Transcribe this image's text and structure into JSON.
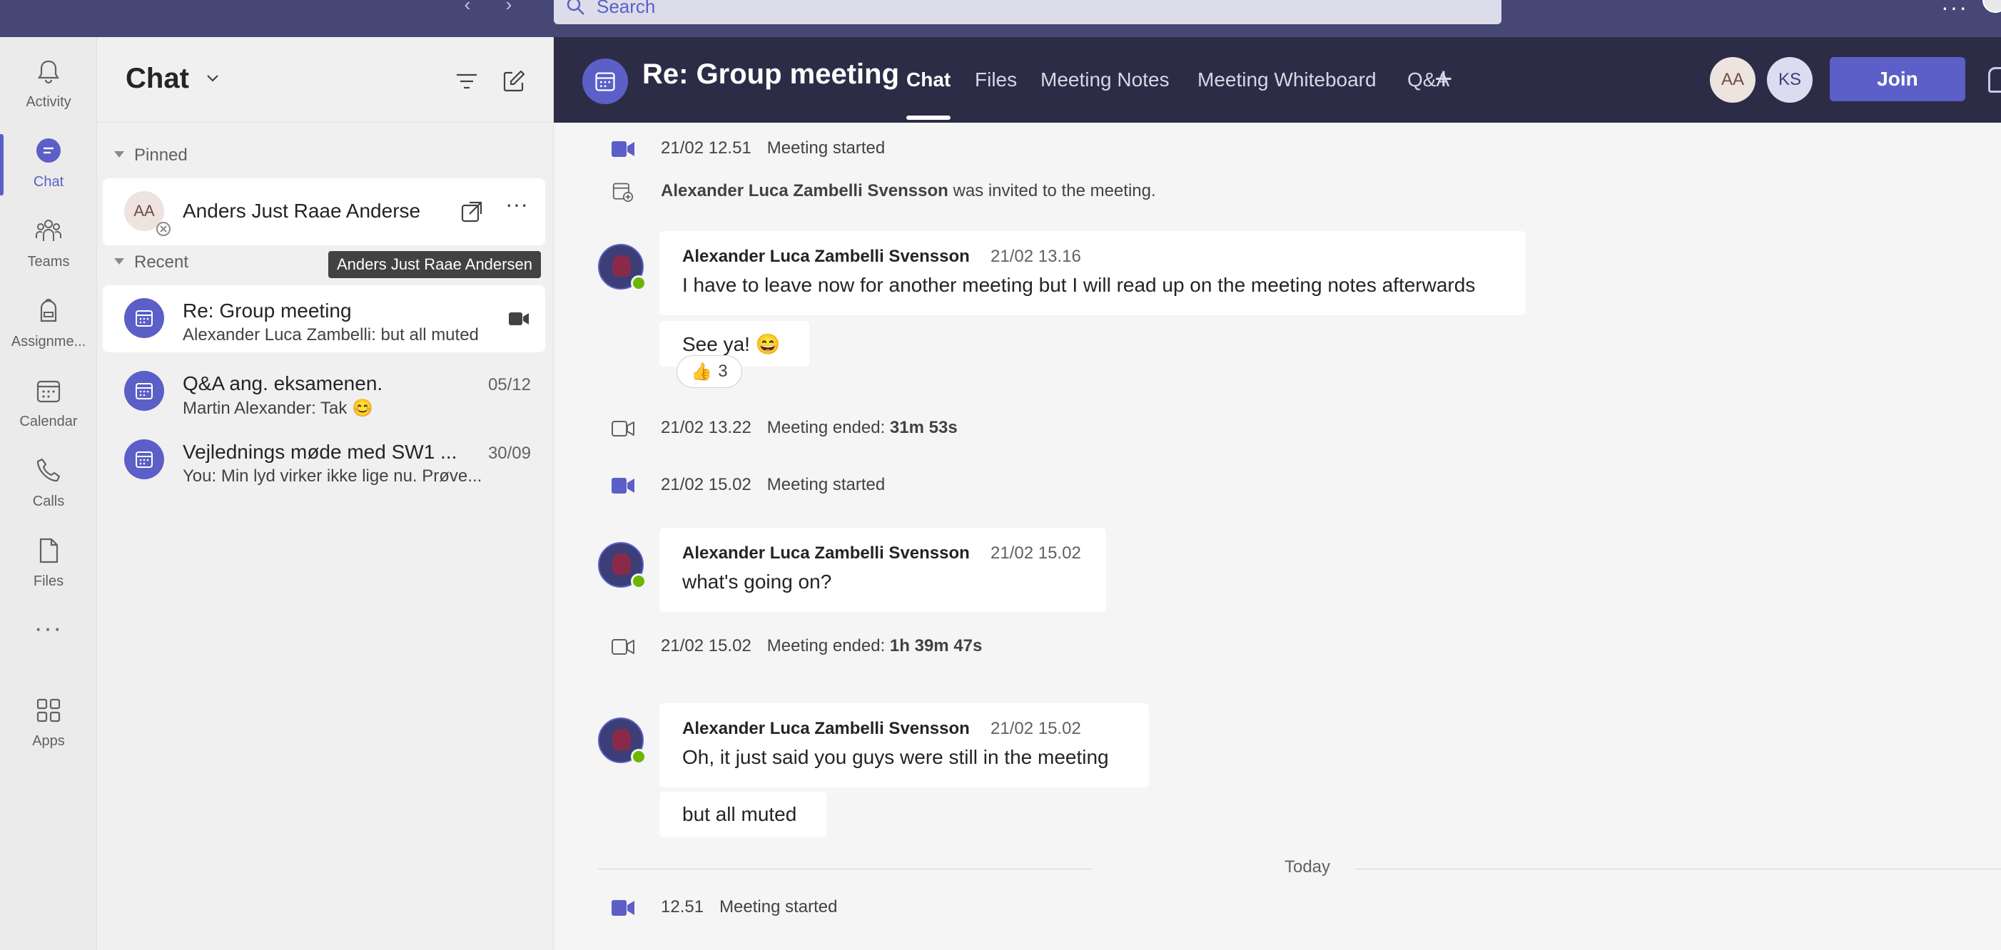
{
  "topbar": {
    "search_placeholder": "Search",
    "back_icon": "chevron-left-icon",
    "forward_icon": "chevron-right-icon"
  },
  "rail": {
    "items": [
      {
        "label": "Activity",
        "icon": "bell-icon"
      },
      {
        "label": "Chat",
        "icon": "chat-icon",
        "active": true
      },
      {
        "label": "Teams",
        "icon": "teams-icon"
      },
      {
        "label": "Assignme...",
        "icon": "backpack-icon"
      },
      {
        "label": "Calendar",
        "icon": "calendar-icon"
      },
      {
        "label": "Calls",
        "icon": "phone-icon"
      },
      {
        "label": "Files",
        "icon": "file-icon"
      },
      {
        "label": "Apps",
        "icon": "apps-icon"
      }
    ]
  },
  "list": {
    "title": "Chat",
    "pinned_label": "Pinned",
    "recent_label": "Recent",
    "pinned": [
      {
        "initials": "AA",
        "name": "Anders Just Raae Andersen",
        "display_name": "Anders Just Raae Anderse"
      }
    ],
    "tooltip": "Anders Just Raae Andersen",
    "recent": [
      {
        "name": "Re: Group meeting",
        "preview": "Alexander Luca Zambelli: but all muted",
        "date": ""
      },
      {
        "name": "Q&A ang. eksamenen.",
        "preview": "Martin Alexander: Tak 😊",
        "date": "05/12"
      },
      {
        "name": "Vejlednings møde med SW1 ...",
        "preview": "You: Min lyd virker ikke lige nu. Prøve...",
        "date": "30/09"
      }
    ]
  },
  "header": {
    "title": "Re: Group meeting",
    "tabs": [
      {
        "label": "Chat",
        "active": true
      },
      {
        "label": "Files"
      },
      {
        "label": "Meeting Notes"
      },
      {
        "label": "Meeting Whiteboard"
      },
      {
        "label": "Q&A"
      }
    ],
    "participants": [
      {
        "initials": "AA",
        "bg": "#ede3df",
        "fg": "#6b4e44"
      },
      {
        "initials": "KS",
        "bg": "#dcdcf0",
        "fg": "#3e3f7a"
      }
    ],
    "join_label": "Join"
  },
  "conversation": {
    "events": [
      {
        "time": "21/02 12.51",
        "text": "Meeting started",
        "bold": ""
      },
      {
        "time": "",
        "text": "was invited to the meeting.",
        "bold": "Alexander Luca Zambelli Svensson"
      },
      {
        "time": "21/02 13.22",
        "text": "Meeting ended: ",
        "bold": "31m 53s"
      },
      {
        "time": "21/02 15.02",
        "text": "Meeting started",
        "bold": ""
      },
      {
        "time": "21/02 15.02",
        "text": "Meeting ended: ",
        "bold": "1h 39m 47s"
      },
      {
        "time": "12.51",
        "text": "Meeting started",
        "bold": ""
      }
    ],
    "messages": [
      {
        "sender": "Alexander Luca Zambelli Svensson",
        "time": "21/02 13.16",
        "text": "I have to leave now for another meeting but I will read up on the meeting notes afterwards"
      },
      {
        "sender": "",
        "time": "",
        "text": "See ya! 😄"
      },
      {
        "sender": "Alexander Luca Zambelli Svensson",
        "time": "21/02 15.02",
        "text": "what's going on?"
      },
      {
        "sender": "Alexander Luca Zambelli Svensson",
        "time": "21/02 15.02",
        "text": "Oh, it just said you guys were still in the meeting"
      },
      {
        "sender": "",
        "time": "",
        "text": "but all muted"
      }
    ],
    "reaction": {
      "emoji": "👍",
      "count": "3"
    },
    "divider_label": "Today"
  },
  "colors": {
    "brand": "#5b5fc7",
    "topbar": "#464775",
    "header": "#2d2c46",
    "presence": "#6bb700"
  }
}
